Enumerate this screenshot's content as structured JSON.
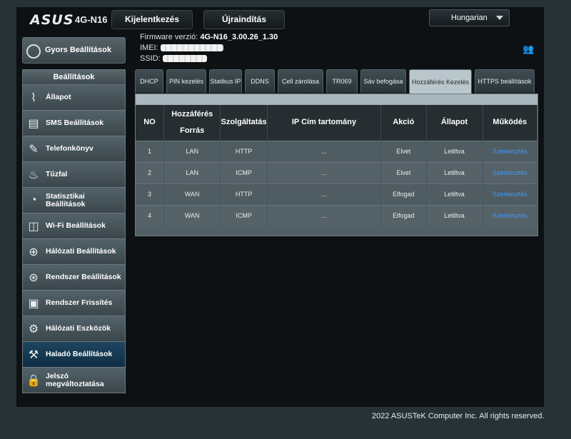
{
  "header": {
    "logo": "ASUS",
    "model": "4G-N16",
    "logout": "Kijelentkezés",
    "reboot": "Újraindítás",
    "language": "Hungarian"
  },
  "sidebar": {
    "quick_setup": "Gyors Beállítások",
    "section": "Beállítások",
    "items": [
      {
        "label": "Állapot",
        "icon": "pulse-icon"
      },
      {
        "label": "SMS Beállítások",
        "icon": "sms-icon"
      },
      {
        "label": "Telefonkönyv",
        "icon": "phonebook-icon"
      },
      {
        "label": "Tűzfal",
        "icon": "firewall-icon"
      },
      {
        "label": "Statisztikai Beállítások",
        "icon": "gauge-icon"
      },
      {
        "label": "Wi-Fi Beállítások",
        "icon": "wifi-icon"
      },
      {
        "label": "Hálózati Beállítások",
        "icon": "globe-icon"
      },
      {
        "label": "Rendszer Beállítások",
        "icon": "globe-gear-icon"
      },
      {
        "label": "Rendszer Frissítés",
        "icon": "update-icon"
      },
      {
        "label": "Hálózati Eszközök",
        "icon": "gear-icon"
      },
      {
        "label": "Haladó Beállítások",
        "icon": "advanced-icon"
      },
      {
        "label": "Jelszó megváltoztatása",
        "icon": "lock-icon"
      }
    ],
    "active_index": 10
  },
  "info": {
    "firmware_label": "Firmware verzió:",
    "firmware_value": "4G-N16_3.00.26_1.30",
    "imei_label": "IMEI:",
    "ssid_label": "SSID:"
  },
  "tabs": [
    "DHCP",
    "PIN kezelés",
    "Statikus IP",
    "DDNS",
    "Cell zárolása",
    "TR069",
    "Sáv befogása",
    "Hozzáférés Kezelés",
    "HTTPS beállítások"
  ],
  "active_tab": 7,
  "table": {
    "headers": [
      "NO",
      "Hozzáférés Forrás",
      "Szolgáltatás",
      "IP Cím tartomány",
      "Akció",
      "Állapot",
      "Működés"
    ],
    "rows": [
      {
        "no": "1",
        "source": "LAN",
        "service": "HTTP",
        "ip": "...",
        "action": "Elvet",
        "status": "Letiltva",
        "op": "Szerkesztés"
      },
      {
        "no": "2",
        "source": "LAN",
        "service": "ICMP",
        "ip": "...",
        "action": "Elvet",
        "status": "Letiltva",
        "op": "Szerkesztés"
      },
      {
        "no": "3",
        "source": "WAN",
        "service": "HTTP",
        "ip": "...",
        "action": "Elfogad",
        "status": "Letiltva",
        "op": "Szerkesztés"
      },
      {
        "no": "4",
        "source": "WAN",
        "service": "ICMP",
        "ip": "...",
        "action": "Elfogad",
        "status": "Letiltva",
        "op": "Szerkesztés"
      }
    ]
  },
  "footer": "2022 ASUSTeK Computer Inc. All rights reserved.",
  "colors": {
    "link": "#3f9bff",
    "active_item": "#1d4560"
  }
}
